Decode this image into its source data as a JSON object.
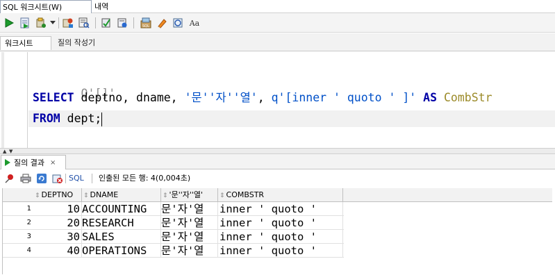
{
  "tabs": {
    "worksheet_tab": "SQL 워크시트(W)",
    "history_tab": "내역"
  },
  "toolbar": {
    "icons": [
      "run-statement-icon",
      "run-script-icon",
      "commit-icon",
      "dropdown-icon",
      "rollback-icon",
      "explain-plan-icon",
      "autotrace-icon",
      "sql-tuning-icon",
      "clear-icon",
      "sql-history-icon",
      "unshared-worksheet-icon",
      "format-case-icon"
    ],
    "case_label": "Aa"
  },
  "subtabs": {
    "worksheet": "워크시트",
    "query_builder": "질의 작성기"
  },
  "editor": {
    "line1": "-- Q'[]'",
    "line2": {
      "kw_select": "SELECT",
      "cols": " deptno, dname, ",
      "str1": "'문''자''열'",
      "comma": ", ",
      "str2": "q'[inner ' quoto ' ]'",
      "kw_as": " AS ",
      "alias": "CombStr"
    },
    "line3": {
      "kw_from": "FROM",
      "rest": " dept;"
    }
  },
  "result": {
    "tab_label": "질의 결과",
    "close_label": "×",
    "sql_label": "SQL",
    "status": "인출된 모든 행: 4(0,004초)",
    "columns": [
      "DEPTNO",
      "DNAME",
      "'문''자''열'",
      "COMBSTR"
    ],
    "rows": [
      {
        "n": "1",
        "deptno": "10",
        "dname": "ACCOUNTING",
        "str": "문'자'열",
        "comb": "inner ' quoto '"
      },
      {
        "n": "2",
        "deptno": "20",
        "dname": "RESEARCH",
        "str": "문'자'열",
        "comb": "inner ' quoto '"
      },
      {
        "n": "3",
        "deptno": "30",
        "dname": "SALES",
        "str": "문'자'열",
        "comb": "inner ' quoto '"
      },
      {
        "n": "4",
        "deptno": "40",
        "dname": "OPERATIONS",
        "str": "문'자'열",
        "comb": "inner ' quoto '"
      }
    ]
  }
}
